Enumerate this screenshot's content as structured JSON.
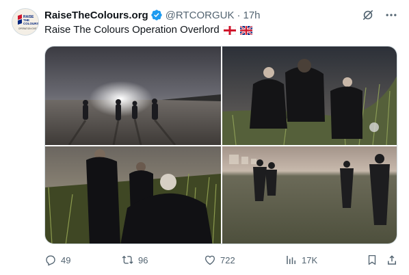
{
  "author": {
    "name": "RaiseTheColours.org",
    "handle": "@RTCORGUK",
    "separator": "·",
    "time": "17h",
    "avatar_logo_text": [
      "RAISE",
      "THE",
      "COLOURS",
      "OPERATION OVERLORD"
    ]
  },
  "tweet": {
    "text": "Raise The Colours Operation Overlord",
    "flags": [
      "england-flag-icon",
      "union-jack-icon"
    ]
  },
  "media": {
    "photos": [
      "beach-walkers-night",
      "dunes-binoculars",
      "marram-grass-group",
      "night-beach-figures"
    ]
  },
  "stats": {
    "replies": "49",
    "reposts": "96",
    "likes": "722",
    "views": "17K"
  },
  "colors": {
    "verified": "#1d9bf0",
    "text_secondary": "#536471",
    "text_primary": "#0f1419",
    "flag_red": "#cf142b",
    "flag_blue": "#00247d"
  }
}
